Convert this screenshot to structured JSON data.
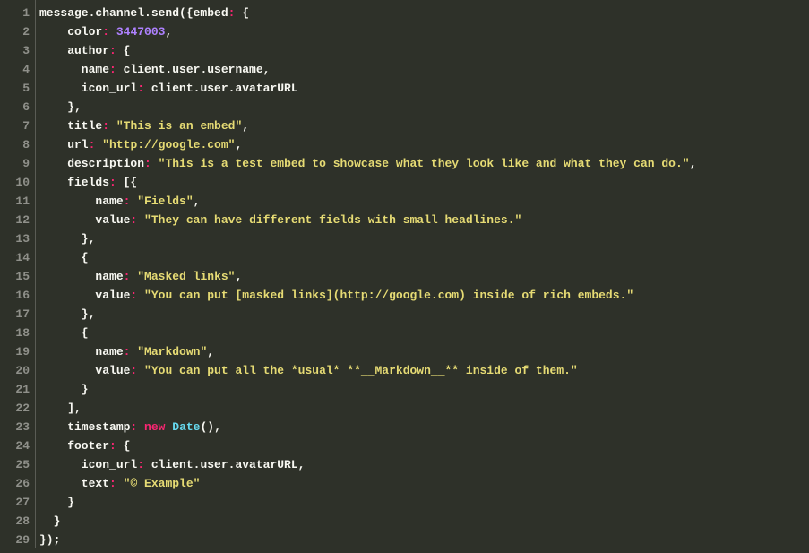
{
  "editor": {
    "line_count": 29,
    "lines": [
      [
        {
          "cls": "tok-default",
          "t": "message.channel.send({embed"
        },
        {
          "cls": "tok-op",
          "t": ":"
        },
        {
          "cls": "tok-default",
          "t": " {"
        }
      ],
      [
        {
          "cls": "tok-default",
          "t": "    color"
        },
        {
          "cls": "tok-op",
          "t": ":"
        },
        {
          "cls": "tok-default",
          "t": " "
        },
        {
          "cls": "tok-number",
          "t": "3447003"
        },
        {
          "cls": "tok-default",
          "t": ","
        }
      ],
      [
        {
          "cls": "tok-default",
          "t": "    author"
        },
        {
          "cls": "tok-op",
          "t": ":"
        },
        {
          "cls": "tok-default",
          "t": " {"
        }
      ],
      [
        {
          "cls": "tok-default",
          "t": "      name"
        },
        {
          "cls": "tok-op",
          "t": ":"
        },
        {
          "cls": "tok-default",
          "t": " client.user.username,"
        }
      ],
      [
        {
          "cls": "tok-default",
          "t": "      icon_url"
        },
        {
          "cls": "tok-op",
          "t": ":"
        },
        {
          "cls": "tok-default",
          "t": " client.user.avatarURL"
        }
      ],
      [
        {
          "cls": "tok-default",
          "t": "    },"
        }
      ],
      [
        {
          "cls": "tok-default",
          "t": "    title"
        },
        {
          "cls": "tok-op",
          "t": ":"
        },
        {
          "cls": "tok-default",
          "t": " "
        },
        {
          "cls": "tok-string",
          "t": "\"This is an embed\""
        },
        {
          "cls": "tok-default",
          "t": ","
        }
      ],
      [
        {
          "cls": "tok-default",
          "t": "    url"
        },
        {
          "cls": "tok-op",
          "t": ":"
        },
        {
          "cls": "tok-default",
          "t": " "
        },
        {
          "cls": "tok-string",
          "t": "\"http://google.com\""
        },
        {
          "cls": "tok-default",
          "t": ","
        }
      ],
      [
        {
          "cls": "tok-default",
          "t": "    description"
        },
        {
          "cls": "tok-op",
          "t": ":"
        },
        {
          "cls": "tok-default",
          "t": " "
        },
        {
          "cls": "tok-string",
          "t": "\"This is a test embed to showcase what they look like and what they can do.\""
        },
        {
          "cls": "tok-default",
          "t": ","
        }
      ],
      [
        {
          "cls": "tok-default",
          "t": "    fields"
        },
        {
          "cls": "tok-op",
          "t": ":"
        },
        {
          "cls": "tok-default",
          "t": " [{"
        }
      ],
      [
        {
          "cls": "tok-default",
          "t": "        name"
        },
        {
          "cls": "tok-op",
          "t": ":"
        },
        {
          "cls": "tok-default",
          "t": " "
        },
        {
          "cls": "tok-string",
          "t": "\"Fields\""
        },
        {
          "cls": "tok-default",
          "t": ","
        }
      ],
      [
        {
          "cls": "tok-default",
          "t": "        value"
        },
        {
          "cls": "tok-op",
          "t": ":"
        },
        {
          "cls": "tok-default",
          "t": " "
        },
        {
          "cls": "tok-string",
          "t": "\"They can have different fields with small headlines.\""
        }
      ],
      [
        {
          "cls": "tok-default",
          "t": "      },"
        }
      ],
      [
        {
          "cls": "tok-default",
          "t": "      {"
        }
      ],
      [
        {
          "cls": "tok-default",
          "t": "        name"
        },
        {
          "cls": "tok-op",
          "t": ":"
        },
        {
          "cls": "tok-default",
          "t": " "
        },
        {
          "cls": "tok-string",
          "t": "\"Masked links\""
        },
        {
          "cls": "tok-default",
          "t": ","
        }
      ],
      [
        {
          "cls": "tok-default",
          "t": "        value"
        },
        {
          "cls": "tok-op",
          "t": ":"
        },
        {
          "cls": "tok-default",
          "t": " "
        },
        {
          "cls": "tok-string",
          "t": "\"You can put [masked links](http://google.com) inside of rich embeds.\""
        }
      ],
      [
        {
          "cls": "tok-default",
          "t": "      },"
        }
      ],
      [
        {
          "cls": "tok-default",
          "t": "      {"
        }
      ],
      [
        {
          "cls": "tok-default",
          "t": "        name"
        },
        {
          "cls": "tok-op",
          "t": ":"
        },
        {
          "cls": "tok-default",
          "t": " "
        },
        {
          "cls": "tok-string",
          "t": "\"Markdown\""
        },
        {
          "cls": "tok-default",
          "t": ","
        }
      ],
      [
        {
          "cls": "tok-default",
          "t": "        value"
        },
        {
          "cls": "tok-op",
          "t": ":"
        },
        {
          "cls": "tok-default",
          "t": " "
        },
        {
          "cls": "tok-string",
          "t": "\"You can put all the *usual* **__Markdown__** inside of them.\""
        }
      ],
      [
        {
          "cls": "tok-default",
          "t": "      }"
        }
      ],
      [
        {
          "cls": "tok-default",
          "t": "    ],"
        }
      ],
      [
        {
          "cls": "tok-default",
          "t": "    timestamp"
        },
        {
          "cls": "tok-op",
          "t": ":"
        },
        {
          "cls": "tok-default",
          "t": " "
        },
        {
          "cls": "tok-op",
          "t": "new"
        },
        {
          "cls": "tok-default",
          "t": " "
        },
        {
          "cls": "tok-keyword",
          "t": "Date"
        },
        {
          "cls": "tok-default",
          "t": "(),"
        }
      ],
      [
        {
          "cls": "tok-default",
          "t": "    footer"
        },
        {
          "cls": "tok-op",
          "t": ":"
        },
        {
          "cls": "tok-default",
          "t": " {"
        }
      ],
      [
        {
          "cls": "tok-default",
          "t": "      icon_url"
        },
        {
          "cls": "tok-op",
          "t": ":"
        },
        {
          "cls": "tok-default",
          "t": " client.user.avatarURL,"
        }
      ],
      [
        {
          "cls": "tok-default",
          "t": "      text"
        },
        {
          "cls": "tok-op",
          "t": ":"
        },
        {
          "cls": "tok-default",
          "t": " "
        },
        {
          "cls": "tok-string",
          "t": "\"© Example\""
        }
      ],
      [
        {
          "cls": "tok-default",
          "t": "    }"
        }
      ],
      [
        {
          "cls": "tok-default",
          "t": "  }"
        }
      ],
      [
        {
          "cls": "tok-default",
          "t": "});"
        }
      ]
    ]
  }
}
